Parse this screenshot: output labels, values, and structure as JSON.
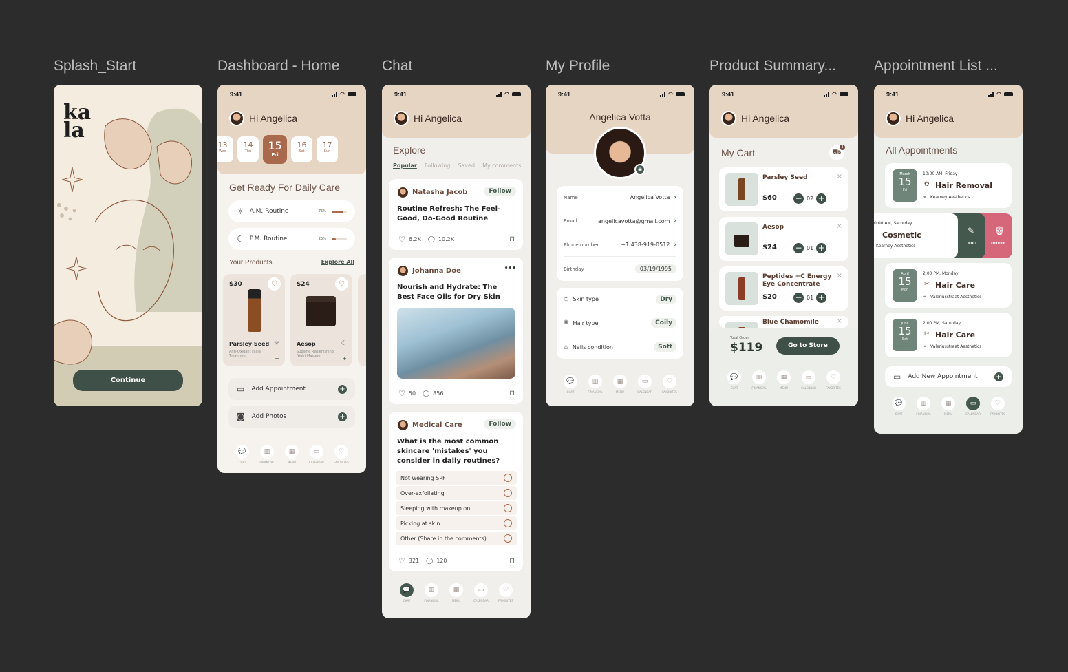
{
  "colors": {
    "background": "#2c2c2c",
    "header": "#e7d5c4",
    "accent": "#45584e",
    "brown": "#a9694c",
    "pink": "#d6667a"
  },
  "frames": {
    "splash": "Splash_Start",
    "dashboard": "Dashboard - Home",
    "chat": "Chat",
    "profile": "My Profile",
    "cart": "Product Summary...",
    "appointments": "Appointment List ..."
  },
  "status": {
    "time": "9:41"
  },
  "greeting": "Hi Angelica",
  "nav": [
    {
      "label": "CHAT",
      "icon": "chat-icon",
      "glyph": "💬"
    },
    {
      "label": "FINANCIAL",
      "icon": "chart-icon",
      "glyph": "▥"
    },
    {
      "label": "MENU",
      "icon": "grid-icon",
      "glyph": "▦"
    },
    {
      "label": "CALENDAR",
      "icon": "calendar-icon",
      "glyph": "▭"
    },
    {
      "label": "FAVORITES",
      "icon": "heart-icon",
      "glyph": "♡"
    }
  ],
  "splash": {
    "logo": "ka la",
    "continue": "Continue"
  },
  "dashboard": {
    "days": [
      {
        "num": "13",
        "day": "Wed"
      },
      {
        "num": "14",
        "day": "Thu"
      },
      {
        "num": "15",
        "day": "Fri"
      },
      {
        "num": "16",
        "day": "Sat"
      },
      {
        "num": "17",
        "day": "Sun"
      }
    ],
    "daily_title": "Get Ready For Daily Care",
    "routines": [
      {
        "label": "A.M. Routine",
        "percent": "75%",
        "value": 0.75,
        "icon": "sun-icon"
      },
      {
        "label": "P.M. Routine",
        "percent": "25%",
        "value": 0.25,
        "icon": "moon-icon"
      }
    ],
    "products_title": "Your Products",
    "explore_all": "Explore All",
    "products": [
      {
        "price": "$30",
        "name": "Parsley Seed",
        "desc": "Anti-Oxidant Facial Treatment"
      },
      {
        "price": "$24",
        "name": "Aesop",
        "desc": "Sublime Replenishing Night Masque"
      }
    ],
    "actions": [
      {
        "label": "Add Appointment",
        "icon": "calendar-icon"
      },
      {
        "label": "Add Photos",
        "icon": "camera-icon"
      }
    ]
  },
  "chat": {
    "explore": "Explore",
    "tabs": [
      "Popular",
      "Following",
      "Saved",
      "My comments"
    ],
    "posts": [
      {
        "author": "Natasha Jacob",
        "action": "Follow",
        "title": "Routine Refresh: The Feel-Good, Do-Good Routine",
        "likes": "6.2K",
        "comments": "10.2K"
      },
      {
        "author": "Johanna Doe",
        "action": "•••",
        "title": "Nourish and Hydrate: The Best Face Oils for Dry Skin",
        "likes": "50",
        "comments": "856"
      },
      {
        "author": "Medical Care",
        "action": "Follow",
        "title": "What is the most common skincare 'mistakes' you consider in daily routines?",
        "likes": "321",
        "comments": "120"
      }
    ],
    "poll": [
      "Not wearing SPF",
      "Over-exfoliating",
      "Sleeping with makeup on",
      "Picking at skin",
      "Other (Share in the comments)"
    ]
  },
  "profile": {
    "name": "Angelica Votta",
    "fields": [
      {
        "label": "Name",
        "value": "Angelica Votta"
      },
      {
        "label": "Email",
        "value": "angelicavotta@gmail.com"
      },
      {
        "label": "Phone number",
        "value": "+1 438-919-0512"
      },
      {
        "label": "Birthday",
        "value": "03/19/1995"
      }
    ],
    "traits": [
      {
        "label": "Skin type",
        "value": "Dry"
      },
      {
        "label": "Hair type",
        "value": "Coily"
      },
      {
        "label": "Nails condition",
        "value": "Soft"
      }
    ]
  },
  "cart": {
    "title": "My Cart",
    "badge": "3",
    "items": [
      {
        "name": "Parsley Seed",
        "price": "$60",
        "qty": "02"
      },
      {
        "name": "Aesop",
        "price": "$24",
        "qty": "01"
      },
      {
        "name": "Peptides +C Energy Eye Concentrate",
        "price": "$20",
        "qty": "01"
      },
      {
        "name": "Blue Chamomile",
        "price": "",
        "qty": ""
      }
    ],
    "total_label": "Total Order",
    "total": "$119",
    "go_store": "Go to Store"
  },
  "appointments": {
    "title": "All Appointments",
    "items": [
      {
        "month": "March",
        "day": "15",
        "dow": "Fri",
        "time": "10:00 AM, Friday",
        "name": "Hair Removal",
        "place": "Kearney Aesthetics"
      },
      {
        "month": "",
        "day": "",
        "dow": "",
        "time": "0:00 AM, Saturday",
        "name": "Cosmetic",
        "place": "Kearney Aesthetics"
      },
      {
        "month": "April",
        "day": "15",
        "dow": "Mon",
        "time": "2:00 PM, Monday",
        "name": "Hair Care",
        "place": "Valeriusstraat Aesthetics"
      },
      {
        "month": "June",
        "day": "15",
        "dow": "Sat",
        "time": "2:00 PM, Saturday",
        "name": "Hair Care",
        "place": "Valeriusstraat Aesthetics"
      }
    ],
    "edit": "EDIT",
    "delete": "DELETE",
    "add_new": "Add New Appointment"
  }
}
